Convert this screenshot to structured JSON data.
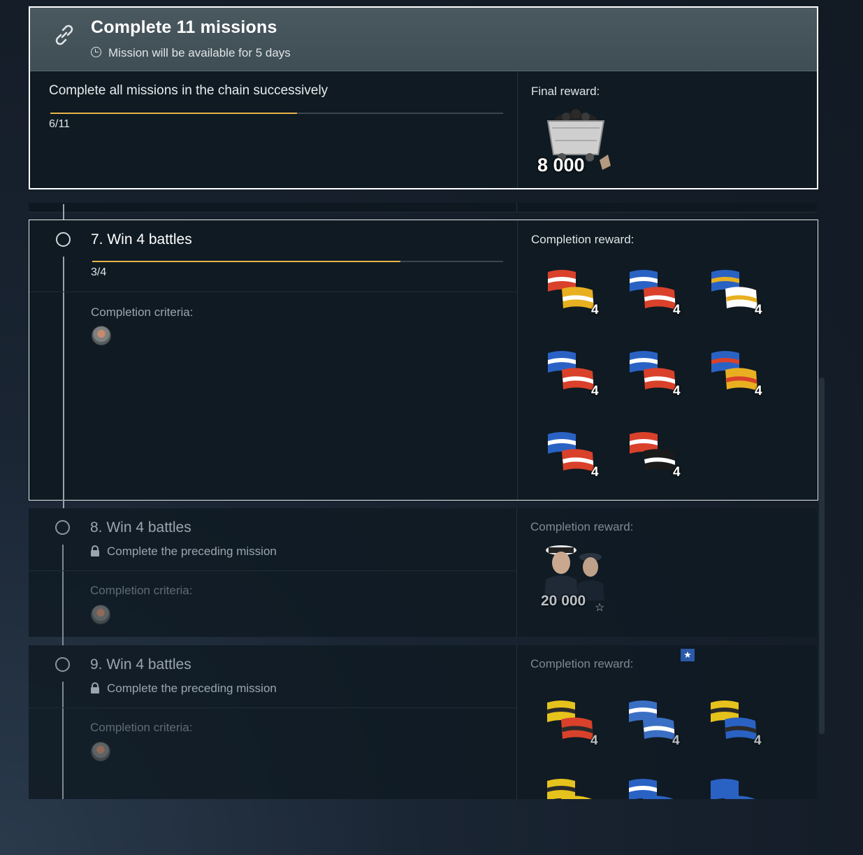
{
  "chain": {
    "title": "Complete 11 missions",
    "availability": "Mission will be available for 5 days",
    "description": "Complete all missions in the chain successively",
    "progress": {
      "current": 6,
      "total": 11,
      "fraction": 0.545,
      "label": "6/11"
    },
    "final_reward_label": "Final reward:",
    "final_reward_amount": "8 000",
    "final_reward_icon": "coal-cart-icon"
  },
  "missions": [
    {
      "title": "7. Win 4 battles",
      "progress": {
        "current": 3,
        "total": 4,
        "fraction": 0.75,
        "label": "3/4"
      },
      "criteria_label": "Completion criteria:",
      "reward_label": "Completion reward:",
      "rewards": [
        {
          "icon": "flag-red-white-striped-icon",
          "qty": "4"
        },
        {
          "icon": "flag-blue-white-red-icon",
          "qty": "4"
        },
        {
          "icon": "flag-saltire-striped-icon",
          "qty": "4"
        },
        {
          "icon": "flag-blue-white-red-square-icon",
          "qty": "4"
        },
        {
          "icon": "flag-checkered-red-icon",
          "qty": "4"
        },
        {
          "icon": "flag-checkered-tricolor-icon",
          "qty": "4"
        },
        {
          "icon": "flag-blue-white-striped-icon",
          "qty": "4"
        },
        {
          "icon": "flag-red-saltire-yellow-icon",
          "qty": "4"
        }
      ]
    },
    {
      "title": "8. Win 4 battles",
      "lock_text": "Complete the preceding mission",
      "criteria_label": "Completion criteria:",
      "reward_label": "Completion reward:",
      "reward_amount": "20 000",
      "reward_icon": "commanders-xp-icon"
    },
    {
      "title": "9. Win 4 battles",
      "lock_text": "Complete the preceding mission",
      "criteria_label": "Completion criteria:",
      "reward_label": "Completion reward:",
      "rewards": [
        {
          "icon": "flag-yellow-dot-striped-icon",
          "qty": "4"
        },
        {
          "icon": "flag-blue-saltire-icon",
          "qty": "4"
        },
        {
          "icon": "flag-yellow-dot-blue-icon",
          "qty": "4"
        },
        {
          "icon": "flag-yellow-dot-icon",
          "qty": ""
        },
        {
          "icon": "flag-blue-cross-icon",
          "qty": ""
        },
        {
          "icon": "flag-blue-icon",
          "qty": ""
        }
      ]
    }
  ],
  "colors": {
    "progress": "#e7b24a",
    "border_active": "#ffffff",
    "badge": "#2a5aa8"
  }
}
